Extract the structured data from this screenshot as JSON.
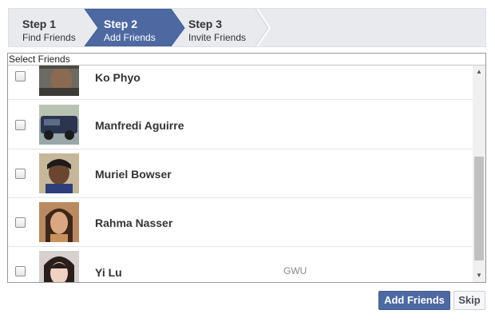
{
  "steps": [
    {
      "num": "Step 1",
      "label": "Find Friends"
    },
    {
      "num": "Step 2",
      "label": "Add Friends"
    },
    {
      "num": "Step 3",
      "label": "Invite Friends"
    }
  ],
  "active_step_color": "#4e69a2",
  "friends_box": {
    "header": "Select Friends",
    "friends": [
      {
        "name": "Ko Phyo",
        "network": "",
        "checked": false
      },
      {
        "name": "Manfredi Aguirre",
        "network": "",
        "checked": false
      },
      {
        "name": "Muriel Bowser",
        "network": "",
        "checked": false
      },
      {
        "name": "Rahma Nasser",
        "network": "",
        "checked": false
      },
      {
        "name": "Yi Lu",
        "network": "GWU",
        "checked": false
      }
    ]
  },
  "scrollbar": {
    "up_icon": "▲",
    "down_icon": "▼"
  },
  "buttons": {
    "add_friends": "Add Friends",
    "skip": "Skip"
  }
}
